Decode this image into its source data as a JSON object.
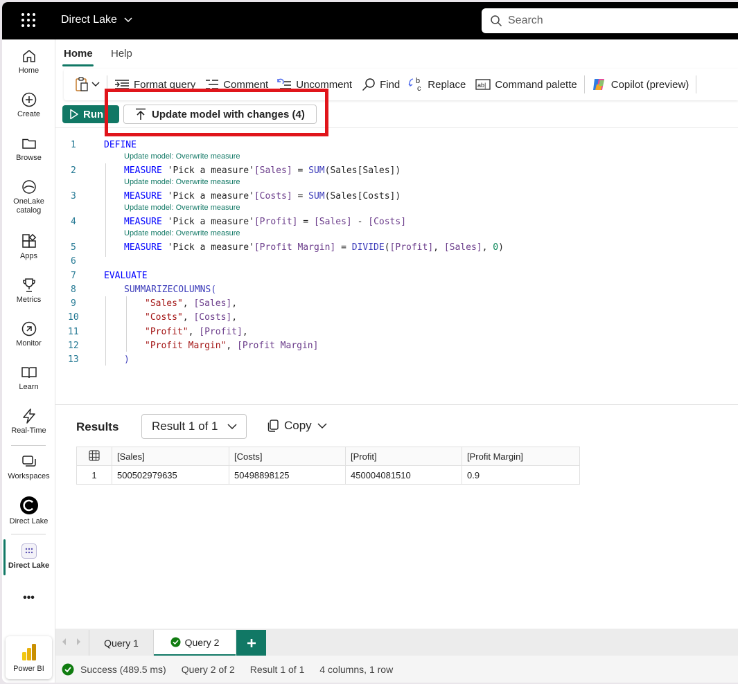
{
  "topbar": {
    "app_title": "Direct Lake",
    "search_placeholder": "Search"
  },
  "rail": {
    "items": [
      {
        "label": "Home"
      },
      {
        "label": "Create"
      },
      {
        "label": "Browse"
      },
      {
        "label": "OneLake catalog"
      },
      {
        "label": "Apps"
      },
      {
        "label": "Metrics"
      },
      {
        "label": "Monitor"
      },
      {
        "label": "Learn"
      },
      {
        "label": "Real-Time"
      },
      {
        "label": "Workspaces"
      },
      {
        "label": "Direct Lake"
      },
      {
        "label": "Direct Lake"
      }
    ],
    "more": "•••",
    "footer": "Power BI"
  },
  "ribbon_tabs": [
    {
      "label": "Home"
    },
    {
      "label": "Help"
    }
  ],
  "toolbar": {
    "format_query": "Format query",
    "comment": "Comment",
    "uncomment": "Uncomment",
    "find": "Find",
    "replace": "Replace",
    "command_palette": "Command palette",
    "copilot": "Copilot (preview)"
  },
  "actions": {
    "run": "Run",
    "update_model": "Update model with changes (4)"
  },
  "editor": {
    "line_numbers": [
      "1",
      "2",
      "3",
      "4",
      "5",
      "6",
      "7",
      "8",
      "9",
      "10",
      "11",
      "12",
      "13"
    ],
    "codelens": "Update model: Overwrite measure",
    "lines": {
      "l1": "DEFINE",
      "l2a": "MEASURE ",
      "l2b": "'Pick a measure'",
      "l2c": "[Sales]",
      "l2d": " = ",
      "l2e": "SUM",
      "l2f": "(Sales",
      "l2g": "[Sales]",
      "l2h": ")",
      "l3a": "MEASURE ",
      "l3b": "'Pick a measure'",
      "l3c": "[Costs]",
      "l3d": " = ",
      "l3e": "SUM",
      "l3f": "(Sales",
      "l3g": "[Costs]",
      "l3h": ")",
      "l4a": "MEASURE ",
      "l4b": "'Pick a measure'",
      "l4c": "[Profit]",
      "l4d": " = ",
      "l4e": "[Sales]",
      "l4f": " - ",
      "l4g": "[Costs]",
      "l5a": "MEASURE ",
      "l5b": "'Pick a measure'",
      "l5c": "[Profit Margin]",
      "l5d": " = ",
      "l5e": "DIVIDE",
      "l5f": "(",
      "l5g": "[Profit]",
      "l5h": ", ",
      "l5i": "[Sales]",
      "l5j": ", ",
      "l5k": "0",
      "l5l": ")",
      "l7": "EVALUATE",
      "l8": "SUMMARIZECOLUMNS(",
      "l9a": "\"Sales\"",
      "l9b": ", ",
      "l9c": "[Sales]",
      "l9d": ",",
      "l10a": "\"Costs\"",
      "l10b": ", ",
      "l10c": "[Costs]",
      "l10d": ",",
      "l11a": "\"Profit\"",
      "l11b": ", ",
      "l11c": "[Profit]",
      "l11d": ",",
      "l12a": "\"Profit Margin\"",
      "l12b": ", ",
      "l12c": "[Profit Margin]",
      "l13": ")"
    }
  },
  "results": {
    "title": "Results",
    "selector": "Result 1 of 1",
    "copy": "Copy",
    "columns": [
      "[Sales]",
      "[Costs]",
      "[Profit]",
      "[Profit Margin]"
    ],
    "rows": [
      {
        "index": "1",
        "cells": [
          "500502979635",
          "50498898125",
          "450004081510",
          "0.9"
        ]
      }
    ]
  },
  "query_tabs": [
    {
      "label": "Query 1"
    },
    {
      "label": "Query 2"
    }
  ],
  "status": {
    "success": "Success (489.5 ms)",
    "query": "Query 2 of 2",
    "result": "Result 1 of 1",
    "shape": "4 columns, 1 row"
  },
  "colors": {
    "accent": "#117865",
    "highlight_box": "#e0151b"
  }
}
